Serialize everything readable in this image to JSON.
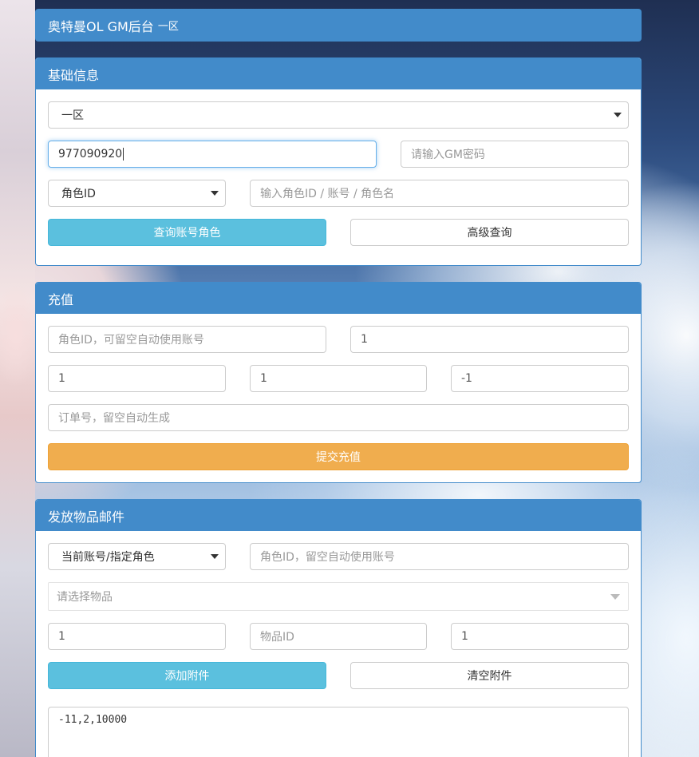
{
  "header": {
    "title": "奥特曼OL GM后台",
    "server_suffix": "一区"
  },
  "basic": {
    "heading": "基础信息",
    "server_select": "一区",
    "account_value": "977090920",
    "gm_password_placeholder": "请输入GM密码",
    "query_type_select": "角色ID",
    "query_placeholder": "输入角色ID / 账号 / 角色名",
    "query_button": "查询账号角色",
    "advanced_button": "高级查询"
  },
  "recharge": {
    "heading": "充值",
    "role_id_placeholder": "角色ID，可留空自动使用账号",
    "amount_value": "1",
    "field_a_value": "1",
    "field_b_value": "1",
    "field_c_value": "-1",
    "order_placeholder": "订单号，留空自动生成",
    "submit_button": "提交充值"
  },
  "mail": {
    "heading": "发放物品邮件",
    "target_select": "当前账号/指定角色",
    "role_id_placeholder": "角色ID，留空自动使用账号",
    "item_select_placeholder": "请选择物品",
    "qty_value": "1",
    "item_id_placeholder": "物品ID",
    "count_value": "1",
    "add_button": "添加附件",
    "clear_button": "清空附件",
    "attachments_text": "-11,2,10000"
  },
  "colors": {
    "primary": "#428bca",
    "info": "#5bc0de",
    "warning": "#f0ad4e"
  }
}
